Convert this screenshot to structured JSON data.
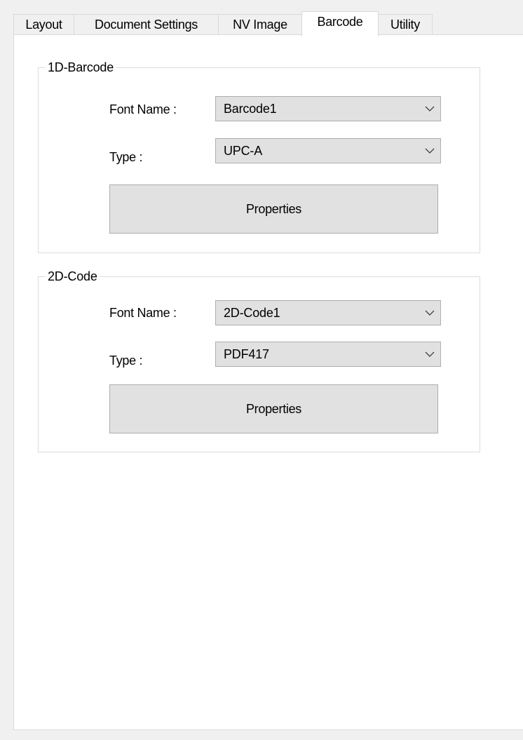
{
  "tabs": [
    {
      "label": "Layout"
    },
    {
      "label": "Document Settings"
    },
    {
      "label": "NV Image"
    },
    {
      "label": "Barcode",
      "active": true
    },
    {
      "label": "Utility"
    }
  ],
  "barcode_1d": {
    "title": "1D-Barcode",
    "font_name_label": "Font Name :",
    "font_name_value": "Barcode1",
    "type_label": "Type :",
    "type_value": "UPC-A",
    "properties_label": "Properties"
  },
  "code_2d": {
    "title": "2D-Code",
    "font_name_label": "Font Name :",
    "font_name_value": "2D-Code1",
    "type_label": "Type :",
    "type_value": "PDF417",
    "properties_label": "Properties"
  },
  "icons": {
    "dropdown": "chevron-down-icon"
  },
  "colors": {
    "panel_bg": "#ffffff",
    "window_bg": "#f0f0f0",
    "control_bg": "#e1e1e1",
    "control_border": "#adadad"
  }
}
